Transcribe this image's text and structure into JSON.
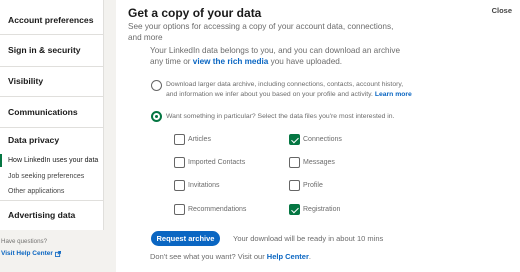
{
  "sidebar": {
    "account_preferences": "Account preferences",
    "sign_in_security": "Sign in & security",
    "visibility": "Visibility",
    "communications": "Communications",
    "data_privacy": "Data privacy",
    "sub_items": [
      "How LinkedIn uses your data",
      "Job seeking preferences",
      "Other applications"
    ],
    "advertising_data": "Advertising data",
    "help_question": "Have questions?",
    "help_link": "Visit Help Center"
  },
  "main": {
    "title": "Get a copy of your data",
    "close_label": "Close",
    "subtitle": "See your options for accessing a copy of your account data, connections, and more",
    "intro_prefix": "Your LinkedIn data belongs to you, and you can download an archive any time or ",
    "intro_link": "view the rich media",
    "intro_suffix": " you have uploaded.",
    "option_full_text": "Download larger data archive, including connections, contacts, account history, and information we infer about you based on your profile and activity. ",
    "option_full_link": "Learn more",
    "option_partial_text": "Want something in particular? Select the data files you're most interested in.",
    "checkboxes": [
      {
        "label": "Articles",
        "checked": false
      },
      {
        "label": "Connections",
        "checked": true
      },
      {
        "label": "Imported Contacts",
        "checked": false
      },
      {
        "label": "Messages",
        "checked": false
      },
      {
        "label": "Invitations",
        "checked": false
      },
      {
        "label": "Profile",
        "checked": false
      },
      {
        "label": "Recommendations",
        "checked": false
      },
      {
        "label": "Registration",
        "checked": true
      }
    ],
    "request_button": "Request archive",
    "ready_text": "Your download will be ready in about 10 mins",
    "footer_prefix": "Don't see what you want? Visit our ",
    "footer_link": "Help Center",
    "footer_suffix": "."
  },
  "colors": {
    "accent_green": "#057642",
    "link_blue": "#0a66c2"
  }
}
